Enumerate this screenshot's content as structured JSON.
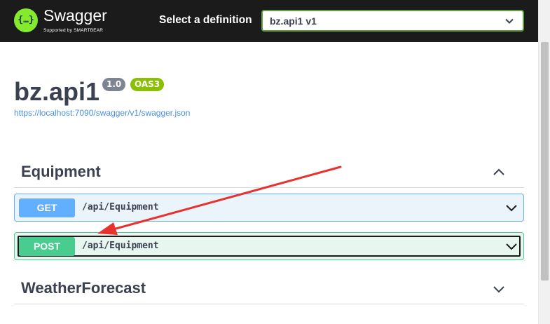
{
  "topbar": {
    "logo_glyph": "{…}",
    "logo_name": "Swagger",
    "logo_tagline": "Supported by SMARTBEAR",
    "definition_label": "Select a definition",
    "definition_value": "bz.api1 v1"
  },
  "info": {
    "title": "bz.api1",
    "version": "1.0",
    "oas": "OAS3",
    "spec_url": "https://localhost:7090/swagger/v1/swagger.json"
  },
  "tags": [
    {
      "name": "Equipment",
      "expanded": true,
      "operations": [
        {
          "method": "GET",
          "path": "/api/Equipment",
          "color": "#61affe"
        },
        {
          "method": "POST",
          "path": "/api/Equipment",
          "color": "#49cc90"
        }
      ]
    },
    {
      "name": "WeatherForecast",
      "expanded": false,
      "operations": []
    }
  ],
  "colors": {
    "topbar": "#1b1b1b",
    "brand_green": "#85ea2d",
    "annotation_arrow": "#e8322d"
  }
}
